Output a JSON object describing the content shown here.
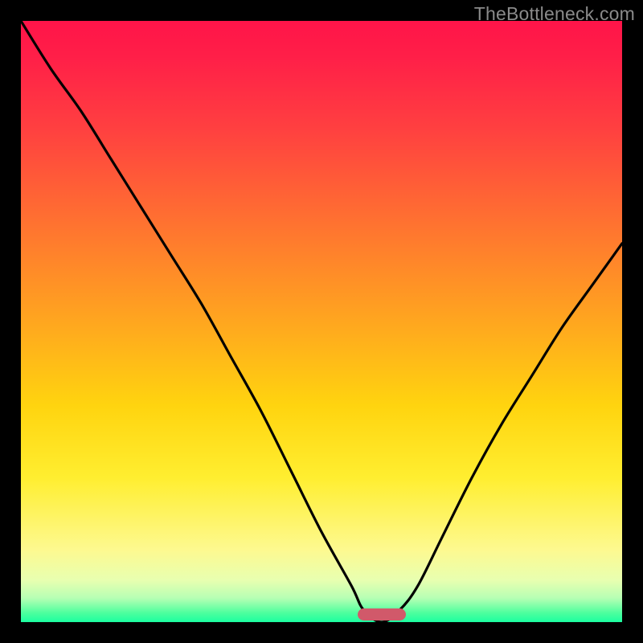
{
  "watermark": "TheBottleneck.com",
  "colors": {
    "frame": "#000000",
    "marker": "#d1596a",
    "curve": "#000000"
  },
  "chart_data": {
    "type": "line",
    "title": "",
    "xlabel": "",
    "ylabel": "",
    "xlim": [
      0,
      100
    ],
    "ylim": [
      0,
      100
    ],
    "grid": false,
    "legend": false,
    "series": [
      {
        "name": "bottleneck-curve",
        "x": [
          0,
          5,
          10,
          15,
          20,
          25,
          30,
          35,
          40,
          45,
          50,
          55,
          57,
          60,
          63,
          66,
          70,
          75,
          80,
          85,
          90,
          95,
          100
        ],
        "values": [
          100,
          92,
          85,
          77,
          69,
          61,
          53,
          44,
          35,
          25,
          15,
          6,
          2,
          0,
          2,
          6,
          14,
          24,
          33,
          41,
          49,
          56,
          63
        ]
      }
    ],
    "background_gradient": {
      "direction": "vertical",
      "stops": [
        {
          "pos": 0.0,
          "color": "#ff1449"
        },
        {
          "pos": 0.34,
          "color": "#ff7330"
        },
        {
          "pos": 0.64,
          "color": "#ffd40f"
        },
        {
          "pos": 0.88,
          "color": "#fdf990"
        },
        {
          "pos": 1.0,
          "color": "#1cffa0"
        }
      ]
    },
    "marker": {
      "x": 60,
      "y": 0,
      "width_pct": 8
    }
  }
}
